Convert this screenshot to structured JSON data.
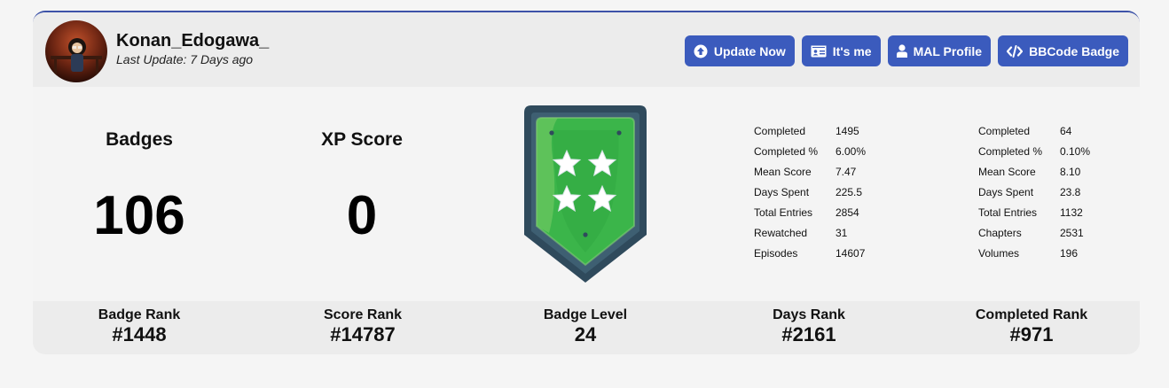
{
  "profile": {
    "username": "Konan_Edogawa_",
    "last_update": "Last Update: 7 Days ago"
  },
  "buttons": {
    "update_now": "Update Now",
    "its_me": "It's me",
    "mal_profile": "MAL Profile",
    "bbcode_badge": "BBCode Badge"
  },
  "stats": {
    "badges_title": "Badges",
    "badges_value": "106",
    "xp_title": "XP Score",
    "xp_value": "0"
  },
  "anime_stats": [
    {
      "label": "Completed",
      "value": "1495"
    },
    {
      "label": "Completed %",
      "value": "6.00%"
    },
    {
      "label": "Mean Score",
      "value": "7.47"
    },
    {
      "label": "Days Spent",
      "value": "225.5"
    },
    {
      "label": "Total Entries",
      "value": "2854"
    },
    {
      "label": "Rewatched",
      "value": "31"
    },
    {
      "label": "Episodes",
      "value": "14607"
    }
  ],
  "manga_stats": [
    {
      "label": "Completed",
      "value": "64"
    },
    {
      "label": "Completed %",
      "value": "0.10%"
    },
    {
      "label": "Mean Score",
      "value": "8.10"
    },
    {
      "label": "Days Spent",
      "value": "23.8"
    },
    {
      "label": "Total Entries",
      "value": "1132"
    },
    {
      "label": "Chapters",
      "value": "2531"
    },
    {
      "label": "Volumes",
      "value": "196"
    }
  ],
  "ranks": [
    {
      "label": "Badge Rank",
      "value": "#1448"
    },
    {
      "label": "Score Rank",
      "value": "#14787"
    },
    {
      "label": "Badge Level",
      "value": "24"
    },
    {
      "label": "Days Rank",
      "value": "#2161"
    },
    {
      "label": "Completed Rank",
      "value": "#971"
    }
  ],
  "colors": {
    "accent": "#3b5bbd",
    "border": "#3d53a8",
    "badge_green": "#3bb54a",
    "badge_frame": "#2f4a5c"
  }
}
